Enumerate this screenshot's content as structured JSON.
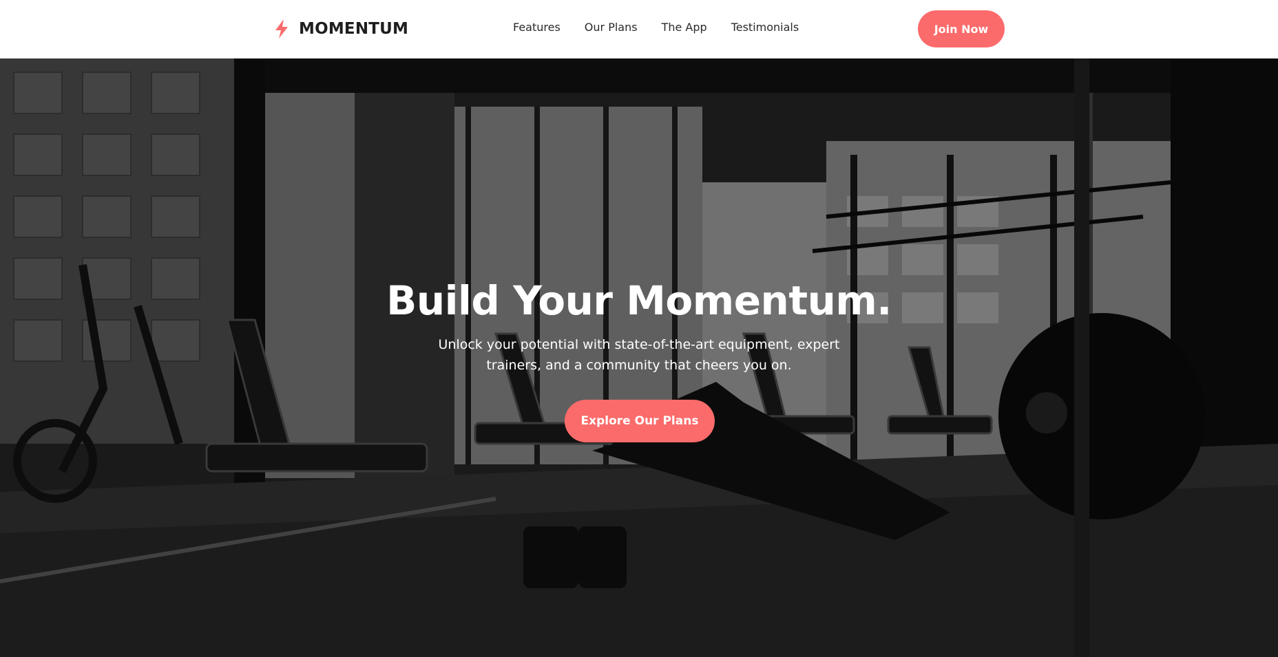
{
  "brand": {
    "name": "MOMENTUM",
    "logo_icon": "lightning-bolt-icon",
    "accent_color": "#fc6b6b"
  },
  "nav": {
    "items": [
      {
        "label": "Features"
      },
      {
        "label": "Our Plans"
      },
      {
        "label": "The App"
      },
      {
        "label": "Testimonials"
      }
    ],
    "cta_label": "Join Now"
  },
  "hero": {
    "title": "Build Your Momentum.",
    "subtitle": "Unlock your potential with state-of-the-art equipment, expert trainers, and a community that cheers you on.",
    "cta_label": "Explore Our Plans",
    "background_image": "gym-interior-photo"
  }
}
